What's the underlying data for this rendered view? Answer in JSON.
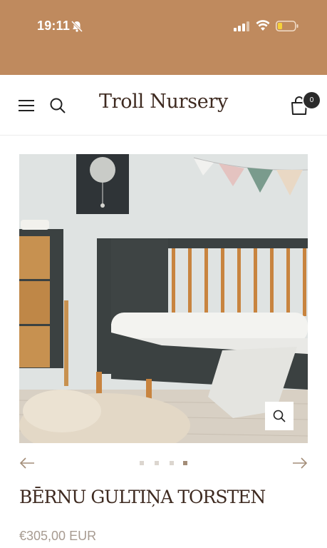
{
  "status_bar": {
    "time": "19:11",
    "bg_color": "#bf8a5e"
  },
  "header": {
    "brand": "Troll Nursery",
    "cart_count": "0",
    "icons": [
      "menu-icon",
      "search-icon",
      "cart-icon"
    ]
  },
  "gallery": {
    "slide_count": 4,
    "active_slide": 4,
    "image_description_icon": "crib-photo"
  },
  "product": {
    "title": "BĒRNU GULTIŅA TORSTEN",
    "price": "€305,00 EUR"
  },
  "colors": {
    "text_dark": "#3e2a20",
    "price": "#a79b91",
    "dot_active": "#a38d78",
    "dot_inactive": "#dcd6cf"
  }
}
